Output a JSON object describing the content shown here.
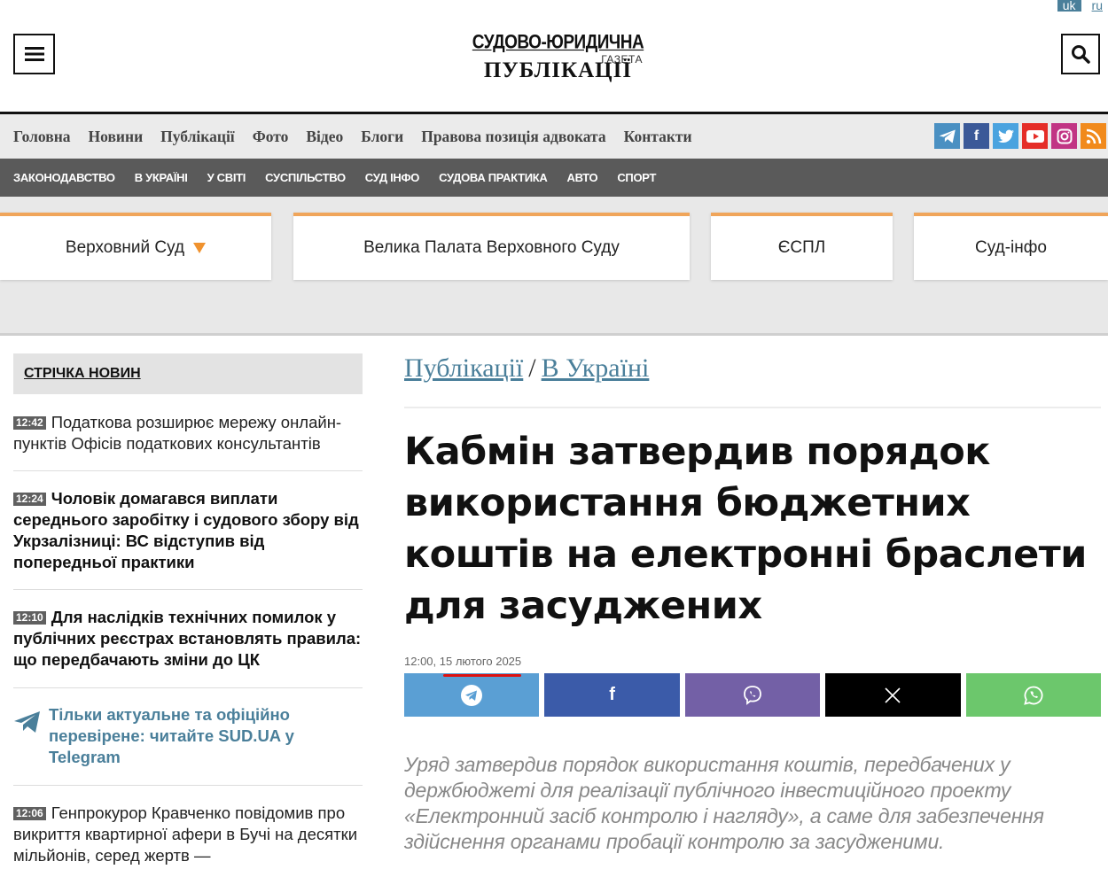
{
  "lang": {
    "uk": "uk",
    "ru": "ru"
  },
  "logo": {
    "line1": "СУДОВО-ЮРИДИЧНА",
    "line2": "ГАЗЕТА",
    "line3": "ПУБЛІКАЦІЇ"
  },
  "mainnav": [
    "Головна",
    "Новини",
    "Публікації",
    "Фото",
    "Відео",
    "Блоги",
    "Правова позиція адвоката",
    "Контакти"
  ],
  "social": [
    {
      "name": "telegram-icon",
      "color": "#4a90c2"
    },
    {
      "name": "facebook-icon",
      "color": "#3b5998"
    },
    {
      "name": "twitter-icon",
      "color": "#4aa3df"
    },
    {
      "name": "youtube-icon",
      "color": "#e52d27"
    },
    {
      "name": "instagram-icon",
      "color": "#c13584"
    },
    {
      "name": "rss-icon",
      "color": "#f18a1c"
    }
  ],
  "categories": [
    "ЗАКОНОДАВСТВО",
    "В УКРАЇНІ",
    "У СВІТІ",
    "СУСПІЛЬСТВО",
    "СУД ІНФО",
    "СУДОВА ПРАКТИКА",
    "АВТО",
    "СПОРТ"
  ],
  "tabs": [
    "Верховний Суд",
    "Велика Палата Верховного Суду",
    "ЄСПЛ",
    "Суд-інфо"
  ],
  "sidebar": {
    "title": "СТРІЧКА НОВИН",
    "news": [
      {
        "time": "12:42",
        "text": "Податкова розширює мережу онлайн-пунктів Офісів податкових консультантів",
        "bold": false
      },
      {
        "time": "12:24",
        "text": "Чоловік домагався виплати середнього заробітку і судового збору від Укрзалізниці: ВС відступив від попередньої практики",
        "bold": true
      },
      {
        "time": "12:10",
        "text": "Для наслідків технічних помилок у публічних реєстрах встановлять правила: що передбачають зміни до ЦК",
        "bold": true
      }
    ],
    "telegram_promo": "Тільки актуальне та офіційно перевірене: читайте SUD.UA у Telegram",
    "news_last": {
      "time": "12:06",
      "text": "Генпрокурор Кравченко повідомив про викриття квартирної афери в Бучі на десятки мільйонів, серед жертв —"
    }
  },
  "article": {
    "crumb1": "Публікації",
    "crumb_sep": "/",
    "crumb2": "В Україні",
    "title": "Кабмін затвердив порядок використання бюджетних коштів на електронні браслети для засуджених",
    "date": "12:00, 15 лютого 2025",
    "share": [
      {
        "name": "share-telegram-button",
        "color": "#5a9fd4"
      },
      {
        "name": "share-facebook-button",
        "color": "#3b5ba9"
      },
      {
        "name": "share-viber-button",
        "color": "#7360a6"
      },
      {
        "name": "share-x-button",
        "color": "#000000"
      },
      {
        "name": "share-whatsapp-button",
        "color": "#6cc76c"
      }
    ],
    "lead": "Уряд затвердив порядок використання коштів, передбачених у держбюджеті для реалізації публічного інвестиційного проекту «Електронний засіб контролю і нагляду», а саме для забезпечення здійснення органами пробації контролю за засудженими."
  }
}
